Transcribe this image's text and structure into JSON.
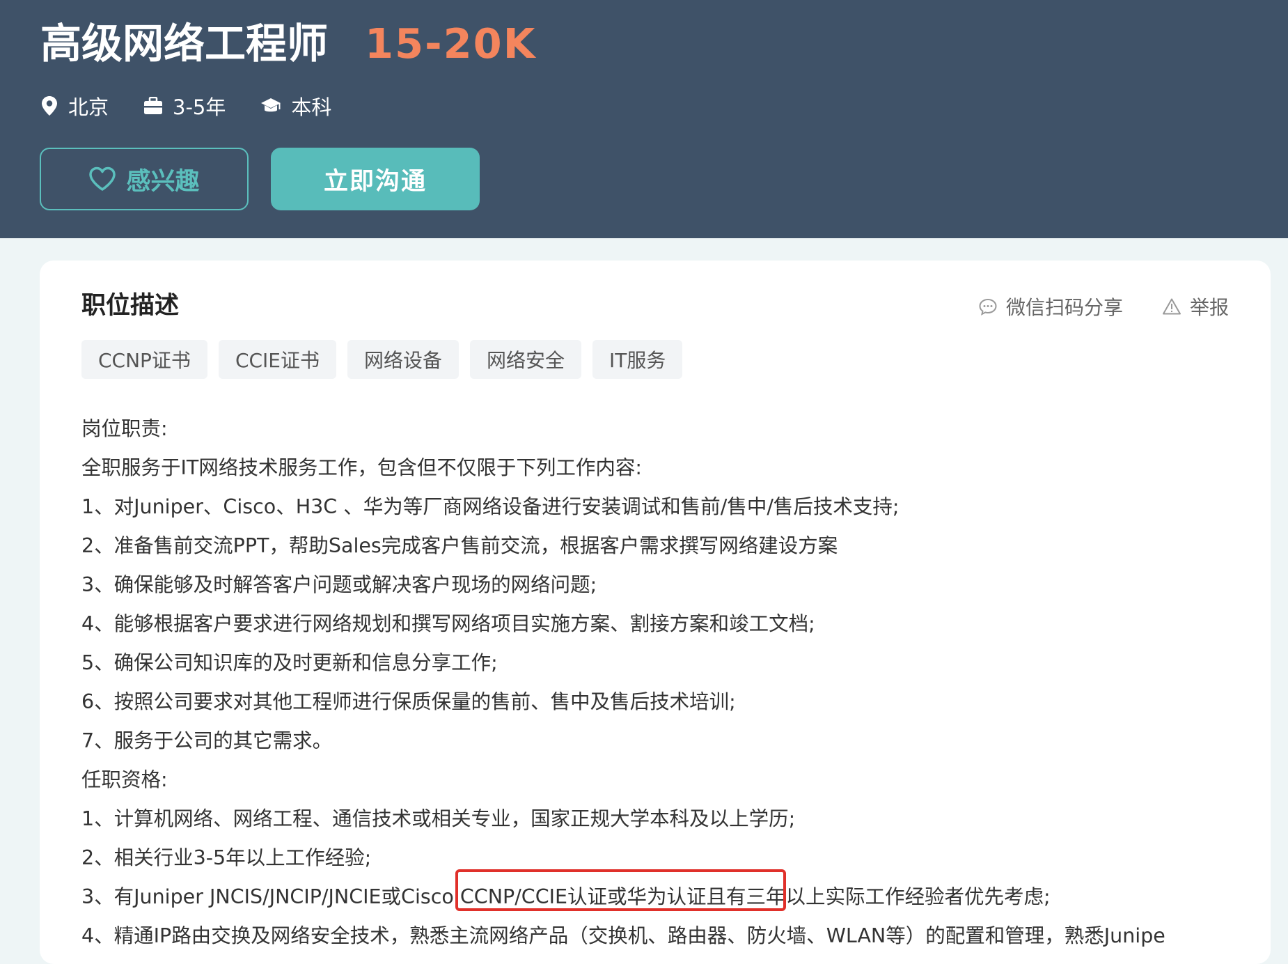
{
  "header": {
    "title": "高级网络工程师",
    "salary": "15-20K",
    "meta": {
      "location": "北京",
      "experience": "3-5年",
      "education": "本科"
    },
    "buttons": {
      "interested": "感兴趣",
      "chat": "立即沟通"
    }
  },
  "colors": {
    "header_bg": "#3f5268",
    "salary": "#f4855d",
    "accent": "#58bcba",
    "highlight_box": "#e0302a"
  },
  "card": {
    "title": "职位描述",
    "actions": {
      "share": "微信扫码分享",
      "report": "举报"
    },
    "tags": [
      "CCNP证书",
      "CCIE证书",
      "网络设备",
      "网络安全",
      "IT服务"
    ],
    "description": [
      "岗位职责:",
      "全职服务于IT网络技术服务工作，包含但不仅限于下列工作内容:",
      "1、对Juniper、Cisco、H3C 、华为等厂商网络设备进行安装调试和售前/售中/售后技术支持;",
      "2、准备售前交流PPT，帮助Sales完成客户售前交流，根据客户需求撰写网络建设方案",
      "3、确保能够及时解答客户问题或解决客户现场的网络问题;",
      "4、能够根据客户要求进行网络规划和撰写网络项目实施方案、割接方案和竣工文档;",
      "5、确保公司知识库的及时更新和信息分享工作;",
      "6、按照公司要求对其他工程师进行保质保量的售前、售中及售后技术培训;",
      "7、服务于公司的其它需求。",
      "任职资格:",
      "1、计算机网络、网络工程、通信技术或相关专业，国家正规大学本科及以上学历;",
      "2、相关行业3-5年以上工作经验;",
      "3、有Juniper JNCIS/JNCIP/JNCIE或Cisco CCNP/CCIE认证或华为认证且有三年以上实际工作经验者优先考虑;",
      "4、精通IP路由交换及网络安全技术，熟悉主流网络产品（交换机、路由器、防火墙、WLAN等）的配置和管理，熟悉Junipe"
    ]
  },
  "icons": {
    "location": "map-pin-icon",
    "experience": "briefcase-icon",
    "education": "graduation-cap-icon",
    "interested": "heart-icon",
    "share": "chat-bubble-icon",
    "report": "warning-triangle-icon"
  }
}
